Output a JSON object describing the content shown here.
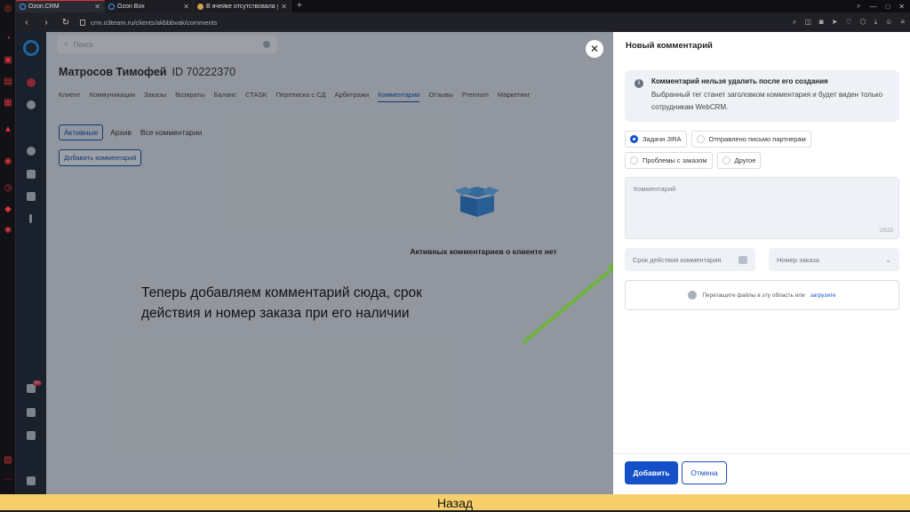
{
  "browser": {
    "tabs": [
      {
        "label": "Ozon.CRM"
      },
      {
        "label": "Ozon Box"
      },
      {
        "label": "В ячейке отсутствовала ук"
      }
    ],
    "url": "crm.o3team.ru/clients/akbbbvak/comments"
  },
  "crm": {
    "search_placeholder": "Поиск",
    "client_name": "Матросов Тимофей",
    "client_id": "ID 70222370",
    "menu": [
      "Клиент",
      "Коммуникации",
      "Заказы",
      "Возвраты",
      "Баланс",
      "СТАSK",
      "Переписка с СД",
      "Арбитражи",
      "Комментарии",
      "Отзывы",
      "Premium",
      "Маркетинг"
    ],
    "menu_selected": "Комментарии",
    "subtabs": [
      "Активные",
      "Архив",
      "Все комментарии"
    ],
    "add_comment_label": "Добавить комментарий",
    "empty_state": "Активных комментариев о клиенте нет",
    "notification_badge": "9+"
  },
  "annotation": {
    "text": "Теперь добавляем комментарий сюда, срок действия и номер заказа при его наличии",
    "arrow_color": "#6fb33f"
  },
  "panel": {
    "title": "Новый комментарий",
    "notice_heading": "Комментарий нельзя удалить после его создания",
    "notice_text": "Выбранный тег станет заголовком комментария и будет виден только сотрудникам WebCRM.",
    "tags": [
      {
        "label": "Задачи JIRA",
        "selected": true
      },
      {
        "label": "Отправлено письмо партнерам",
        "selected": false
      },
      {
        "label": "Проблемы с заказом",
        "selected": false
      },
      {
        "label": "Другое",
        "selected": false
      }
    ],
    "comment_placeholder": "Комментарий",
    "comment_counter": "0/520",
    "expiry_placeholder": "Срок действия комментария",
    "order_placeholder": "Номер заказа",
    "dropzone_text": "Перетащите файлы в эту область или",
    "dropzone_link": "загрузите",
    "submit_label": "Добавить",
    "cancel_label": "Отмена"
  },
  "footer": {
    "back_label": "Назад"
  },
  "colors": {
    "accent": "#1450c8",
    "brand": "#2a9af0",
    "footer": "#f5cf6a"
  }
}
